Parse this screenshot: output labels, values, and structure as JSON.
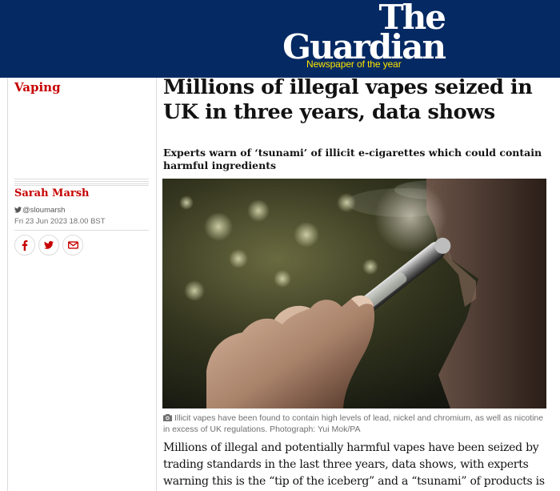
{
  "masthead": {
    "logo_line1": "The",
    "logo_line2": "Guardian",
    "tagline": "Newspaper of the year",
    "background_color": "#052962",
    "tagline_color": "#ffe500"
  },
  "sidebar": {
    "section": "Vaping",
    "author": "Sarah Marsh",
    "twitter_handle": "@sloumarsh",
    "date": "Fri 23 Jun 2023 18.00 BST",
    "share_icons": [
      "facebook-icon",
      "twitter-icon",
      "email-icon"
    ],
    "accent_color": "#c70000"
  },
  "article": {
    "headline": "Millions of illegal vapes seized in UK in three years, data shows",
    "standfirst": "Experts warn of ‘tsunami’ of illicit e-cigarettes which could contain harmful ingredients",
    "image_caption": "Illicit vapes have been found to contain high levels of lead, nickel and chromium, as well as nicotine in excess of UK regulations. Photograph: Yui Mok/PA",
    "body_first_paragraph": "Millions of illegal and potentially harmful vapes have been seized by trading standards in the last three years, data shows, with experts warning this is the “tip of the iceberg” and a “tsunami” of products is flooding into the UK."
  }
}
